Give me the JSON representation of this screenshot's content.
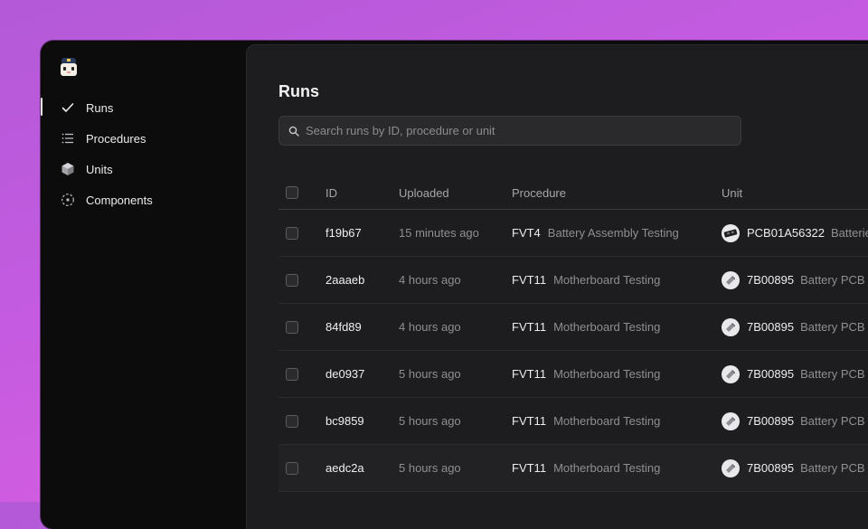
{
  "nav": {
    "items": [
      {
        "label": "Runs",
        "active": true
      },
      {
        "label": "Procedures"
      },
      {
        "label": "Units"
      },
      {
        "label": "Components"
      }
    ]
  },
  "main": {
    "title": "Runs",
    "search": {
      "placeholder": "Search runs by ID, procedure or unit",
      "value": ""
    }
  },
  "table": {
    "headers": {
      "id": "ID",
      "uploaded": "Uploaded",
      "procedure": "Procedure",
      "unit": "Unit"
    },
    "rows": [
      {
        "id": "f19b67",
        "uploaded": "15 minutes ago",
        "proc_code": "FVT4",
        "proc_name": "Battery Assembly Testing",
        "unit_serial": "PCB01A56322",
        "unit_part": "Batterie",
        "unit_icon": "pcb-board-icon"
      },
      {
        "id": "2aaaeb",
        "uploaded": "4 hours ago",
        "proc_code": "FVT11",
        "proc_name": "Motherboard Testing",
        "unit_serial": "7B00895",
        "unit_part": "Battery PCB",
        "unit_icon": "battery-module-icon"
      },
      {
        "id": "84fd89",
        "uploaded": "4 hours ago",
        "proc_code": "FVT11",
        "proc_name": "Motherboard Testing",
        "unit_serial": "7B00895",
        "unit_part": "Battery PCB",
        "unit_icon": "battery-module-icon"
      },
      {
        "id": "de0937",
        "uploaded": "5 hours ago",
        "proc_code": "FVT11",
        "proc_name": "Motherboard Testing",
        "unit_serial": "7B00895",
        "unit_part": "Battery PCB",
        "unit_icon": "battery-module-icon"
      },
      {
        "id": "bc9859",
        "uploaded": "5 hours ago",
        "proc_code": "FVT11",
        "proc_name": "Motherboard Testing",
        "unit_serial": "7B00895",
        "unit_part": "Battery PCB",
        "unit_icon": "battery-module-icon"
      },
      {
        "id": "aedc2a",
        "uploaded": "5 hours ago",
        "proc_code": "FVT11",
        "proc_name": "Motherboard Testing",
        "unit_serial": "7B00895",
        "unit_part": "Battery PCB",
        "unit_icon": "battery-module-icon"
      }
    ]
  },
  "colors": {
    "accent": "#c45be0",
    "background": "#1d1d1f",
    "sidebar": "#0c0c0d"
  },
  "icons": {
    "logo": "robot-pilot-logo",
    "runs": "check-icon",
    "procedures": "list-icon",
    "units": "cube-icon",
    "components": "component-icon",
    "search": "search-icon"
  }
}
